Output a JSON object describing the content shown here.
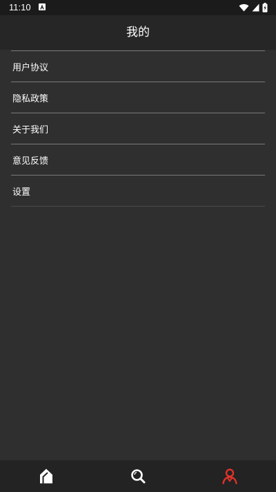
{
  "status_bar": {
    "time": "11:10"
  },
  "app_bar": {
    "title": "我的"
  },
  "menu": {
    "items": [
      {
        "label": "用户协议"
      },
      {
        "label": "隐私政策"
      },
      {
        "label": "关于我们"
      },
      {
        "label": "意见反馈"
      },
      {
        "label": "设置"
      }
    ]
  },
  "bottom_nav": {
    "items": [
      {
        "icon": "home-icon",
        "active": false
      },
      {
        "icon": "search-icon",
        "active": false
      },
      {
        "icon": "profile-icon",
        "active": true
      }
    ]
  },
  "colors": {
    "background": "#2f2f2f",
    "app_bar": "#262626",
    "status_bar": "#1b1b1b",
    "bottom_nav": "#232323",
    "divider": "#7a7a7a",
    "active_accent": "#e0322a",
    "inactive_icon": "#ffffff"
  }
}
